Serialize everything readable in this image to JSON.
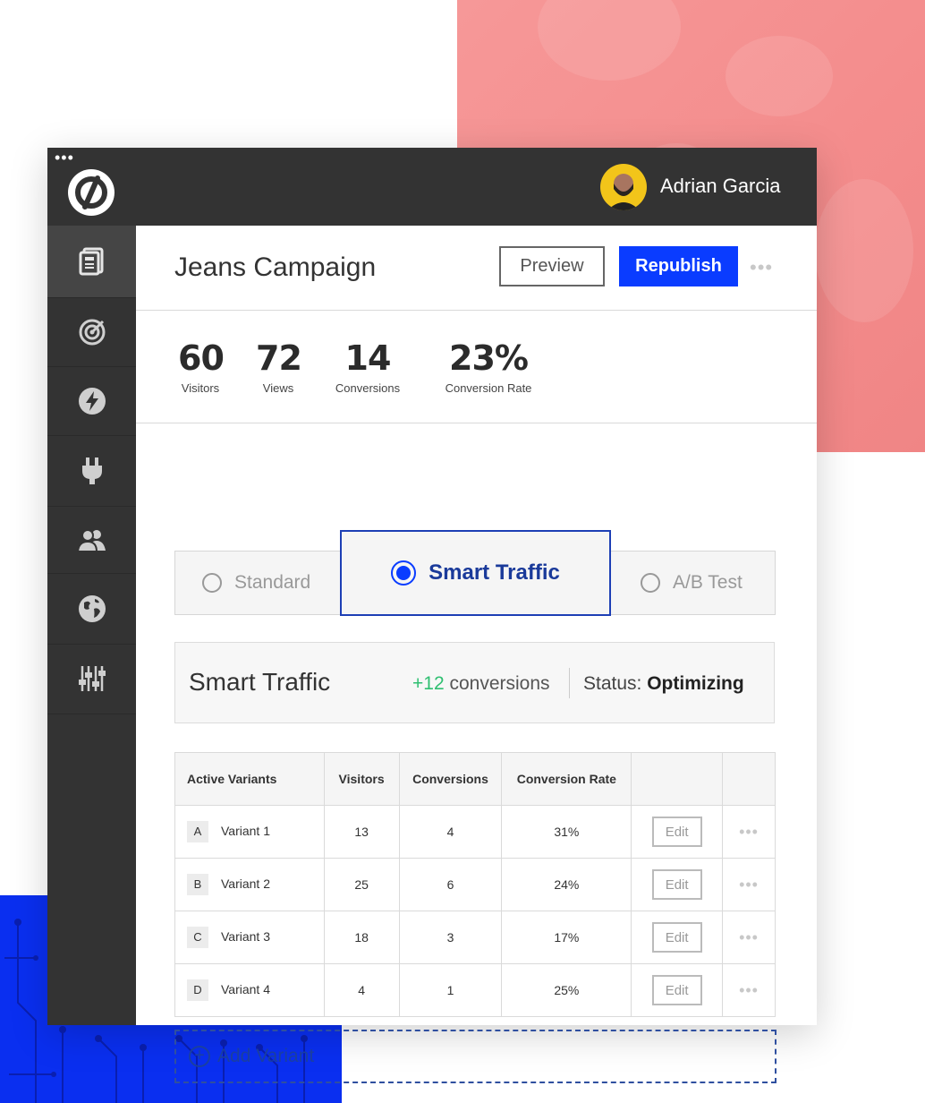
{
  "user": {
    "name": "Adrian Garcia"
  },
  "page": {
    "title": "Jeans Campaign",
    "preview_label": "Preview",
    "republish_label": "Republish"
  },
  "stats": [
    {
      "value": "60",
      "label": "Visitors"
    },
    {
      "value": "72",
      "label": "Views"
    },
    {
      "value": "14",
      "label": "Conversions"
    },
    {
      "value": "23%",
      "label": "Conversion Rate"
    }
  ],
  "modes": {
    "standard": "Standard",
    "smart": "Smart Traffic",
    "ab": "A/B Test",
    "selected": "Smart Traffic"
  },
  "smart_traffic": {
    "title": "Smart Traffic",
    "conv_delta": "+12",
    "conv_word": "conversions",
    "status_label": "Status:",
    "status_value": "Optimizing"
  },
  "table": {
    "headers": [
      "Active Variants",
      "Visitors",
      "Conversions",
      "Conversion Rate"
    ],
    "rows": [
      {
        "letter": "A",
        "name": "Variant 1",
        "visitors": "13",
        "conversions": "4",
        "rate": "31%"
      },
      {
        "letter": "B",
        "name": "Variant 2",
        "visitors": "25",
        "conversions": "6",
        "rate": "24%"
      },
      {
        "letter": "C",
        "name": "Variant 3",
        "visitors": "18",
        "conversions": "3",
        "rate": "17%"
      },
      {
        "letter": "D",
        "name": "Variant 4",
        "visitors": "4",
        "conversions": "1",
        "rate": "25%"
      }
    ],
    "edit_label": "Edit"
  },
  "add_variant_label": "Add Variant",
  "sidebar": [
    "pages-icon",
    "target-icon",
    "bolt-icon",
    "plug-icon",
    "users-icon",
    "globe-icon",
    "sliders-icon"
  ],
  "colors": {
    "accent": "#0a3cff",
    "dark": "#333333",
    "positive": "#2fbf71"
  }
}
